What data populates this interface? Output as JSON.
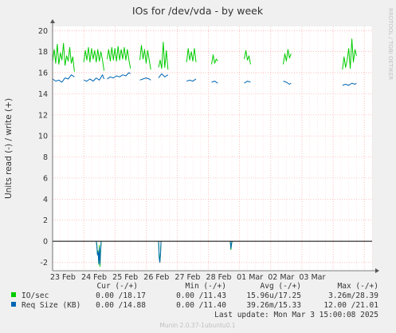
{
  "chart_data": {
    "type": "line",
    "title": "IOs for /dev/vda - by week",
    "ylabel": "Units read (-) / write (+)",
    "watermark": "RRDTOOL / TOBI OETIKER",
    "ylim": [
      -2.8,
      20.4
    ],
    "y_ticks": [
      20,
      18,
      16,
      14,
      12,
      10,
      8,
      6,
      4,
      2,
      0,
      -2
    ],
    "y_tick_labels": [
      "20",
      "18",
      "16",
      "14",
      "12",
      "10",
      "8",
      "6",
      "4",
      "2",
      "0",
      "-2"
    ],
    "x_range_days": [
      0,
      10.25
    ],
    "x_tick_labels": [
      "23 Feb",
      "24 Feb",
      "25 Feb",
      "26 Feb",
      "27 Feb",
      "28 Feb",
      "01 Mar",
      "02 Mar",
      "03 Mar"
    ],
    "grid": true,
    "colors": {
      "io": "#00cc00",
      "req": "#0066b3",
      "grid": "#ff9999",
      "zero": "#000000",
      "background": "#f0f0f0",
      "plot_bg": "#ffffff"
    },
    "series": [
      {
        "name": "IO/sec",
        "color": "#00cc00",
        "segments": [
          {
            "x": [
              0.0,
              0.05,
              0.1,
              0.15,
              0.2,
              0.25,
              0.3,
              0.35,
              0.4,
              0.45,
              0.5,
              0.55,
              0.6,
              0.65,
              0.7
            ],
            "y": [
              17.1,
              18.2,
              16.9,
              18.7,
              16.8,
              17.9,
              17.2,
              18.8,
              16.7,
              17.6,
              17.1,
              18.4,
              16.9,
              17.5,
              16.1
            ]
          },
          {
            "x": [
              1.0,
              1.05,
              1.1,
              1.15,
              1.2,
              1.25,
              1.3,
              1.35,
              1.4,
              1.45,
              1.5,
              1.55,
              1.6,
              1.65
            ],
            "y": [
              17.0,
              18.1,
              17.2,
              18.4,
              17.0,
              18.3,
              17.3,
              18.1,
              17.0,
              18.2,
              17.1,
              18.0,
              17.2,
              16.2
            ]
          },
          {
            "x": [
              1.75,
              1.8,
              1.85,
              1.9,
              1.95,
              2.0,
              2.05,
              2.1,
              2.15,
              2.2,
              2.25,
              2.3,
              2.35,
              2.4,
              2.45,
              2.5
            ],
            "y": [
              17.3,
              18.2,
              17.1,
              18.4,
              17.2,
              18.3,
              17.1,
              18.5,
              17.2,
              18.2,
              17.3,
              18.4,
              17.2,
              18.2,
              17.2,
              16.4
            ]
          },
          {
            "x": [
              2.8,
              2.85,
              2.9,
              2.95,
              3.0,
              3.05,
              3.1,
              3.15
            ],
            "y": [
              17.2,
              18.6,
              17.3,
              18.2,
              16.9,
              18.1,
              17.2,
              16.3
            ]
          },
          {
            "x": [
              3.4,
              3.45,
              3.5,
              3.55,
              3.6,
              3.65,
              3.7
            ],
            "y": [
              16.5,
              17.2,
              16.4,
              18.9,
              16.5,
              18.1,
              16.3
            ]
          },
          {
            "x": [
              4.3,
              4.35,
              4.4,
              4.45,
              4.5,
              4.55,
              4.6
            ],
            "y": [
              17.0,
              18.3,
              17.2,
              18.0,
              17.1,
              18.3,
              17.0
            ]
          },
          {
            "x": [
              5.1,
              5.15,
              5.2,
              5.25,
              5.3
            ],
            "y": [
              16.8,
              17.7,
              16.9,
              17.3,
              17.1
            ]
          },
          {
            "x": [
              6.15,
              6.2,
              6.25,
              6.3,
              6.35
            ],
            "y": [
              17.3,
              18.1,
              17.2,
              17.6,
              16.8
            ]
          },
          {
            "x": [
              7.4,
              7.45,
              7.5,
              7.55,
              7.6,
              7.65
            ],
            "y": [
              16.8,
              17.8,
              17.1,
              18.2,
              17.4,
              17.8
            ]
          },
          {
            "x": [
              9.3,
              9.35,
              9.4,
              9.45,
              9.5,
              9.55,
              9.6,
              9.65,
              9.7,
              9.75
            ],
            "y": [
              16.3,
              17.5,
              16.5,
              17.2,
              18.3,
              16.4,
              19.2,
              17.0,
              18.2,
              17.6
            ]
          }
        ]
      },
      {
        "name": "Req Size (KB)",
        "color": "#0066b3",
        "segments": [
          {
            "x": [
              0.0,
              0.1,
              0.2,
              0.3,
              0.4,
              0.5,
              0.6,
              0.7
            ],
            "y": [
              15.4,
              15.2,
              15.3,
              15.1,
              15.5,
              15.4,
              15.8,
              15.6
            ]
          },
          {
            "x": [
              1.0,
              1.1,
              1.2,
              1.3,
              1.4,
              1.5,
              1.6,
              1.65
            ],
            "y": [
              15.3,
              15.2,
              15.4,
              15.2,
              15.5,
              15.3,
              15.8,
              15.4
            ]
          },
          {
            "x": [
              1.75,
              1.85,
              1.95,
              2.05,
              2.15,
              2.25,
              2.35,
              2.45,
              2.5
            ],
            "y": [
              15.4,
              15.6,
              15.5,
              15.7,
              15.6,
              15.8,
              15.7,
              16.0,
              15.9
            ]
          },
          {
            "x": [
              2.8,
              2.9,
              3.0,
              3.1,
              3.15
            ],
            "y": [
              15.3,
              15.4,
              15.5,
              15.4,
              15.3
            ]
          },
          {
            "x": [
              3.4,
              3.5,
              3.6,
              3.7
            ],
            "y": [
              15.5,
              15.9,
              15.6,
              15.8
            ]
          },
          {
            "x": [
              4.3,
              4.4,
              4.5,
              4.6
            ],
            "y": [
              15.2,
              15.3,
              15.2,
              15.4
            ]
          },
          {
            "x": [
              5.1,
              5.2,
              5.3
            ],
            "y": [
              15.1,
              15.2,
              15.0
            ]
          },
          {
            "x": [
              6.15,
              6.25,
              6.35
            ],
            "y": [
              15.0,
              15.2,
              15.1
            ]
          },
          {
            "x": [
              7.4,
              7.5,
              7.6,
              7.65
            ],
            "y": [
              15.2,
              15.1,
              14.9,
              15.0
            ]
          },
          {
            "x": [
              9.3,
              9.4,
              9.5,
              9.6,
              9.7,
              9.75
            ],
            "y": [
              14.8,
              14.9,
              14.8,
              15.0,
              14.9,
              15.0
            ]
          }
        ]
      },
      {
        "name": "IO/sec (read)",
        "color": "#00cc00",
        "segments": [
          {
            "x": [
              1.4,
              1.42,
              1.44,
              1.46,
              1.48,
              1.5,
              1.52,
              1.54,
              1.56
            ],
            "y": [
              0,
              -0.3,
              -1.2,
              -0.9,
              -2.2,
              -0.4,
              -2.4,
              -1.1,
              0
            ]
          },
          {
            "x": [
              3.4,
              3.42,
              3.44,
              3.46,
              3.48
            ],
            "y": [
              0,
              -1.4,
              -2.0,
              -1.2,
              0
            ]
          },
          {
            "x": [
              5.7,
              5.72,
              5.74,
              5.76
            ],
            "y": [
              0,
              -0.8,
              -0.3,
              0
            ]
          }
        ]
      },
      {
        "name": "Req Size (read)",
        "color": "#0066b3",
        "segments": [
          {
            "x": [
              1.4,
              1.42,
              1.44,
              1.46,
              1.48,
              1.5,
              1.52,
              1.54,
              1.56
            ],
            "y": [
              0,
              -0.5,
              -1.3,
              -1.0,
              -2.1,
              -0.6,
              -2.2,
              -1.0,
              0
            ]
          },
          {
            "x": [
              3.4,
              3.42,
              3.44,
              3.46,
              3.48
            ],
            "y": [
              0,
              -1.6,
              -2.0,
              -1.3,
              0
            ]
          },
          {
            "x": [
              5.7,
              5.72,
              5.74,
              5.76
            ],
            "y": [
              0,
              -0.7,
              -0.2,
              0
            ]
          }
        ]
      }
    ]
  },
  "legend": {
    "headers": [
      "Cur (-/+)",
      "Min (-/+)",
      "Avg (-/+)",
      "Max (-/+)"
    ],
    "rows": [
      {
        "label": "IO/sec",
        "color": "#00cc00",
        "cur": "0.00 /18.17",
        "min": "0.00 /11.43",
        "avg": "15.96u/17.25",
        "max": "3.26m/28.39"
      },
      {
        "label": "Req Size (KB)",
        "color": "#0066b3",
        "cur": "0.00 /14.88",
        "min": "0.00 /11.40",
        "avg": "39.26m/15.33",
        "max": "12.00 /21.01"
      }
    ],
    "last_update": "Last update: Mon Mar  3 15:00:08 2025",
    "footer": "Munin 2.0.37-1ubuntu0.1"
  }
}
